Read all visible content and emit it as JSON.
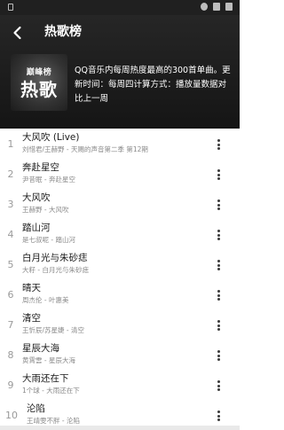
{
  "header": {
    "title": "热歌榜",
    "cover_top_text": "巅峰榜",
    "cover_main_text": "热歌",
    "description": "QQ音乐内每周热度最高的300首单曲。更新时间：每周四计算方式：播放量数据对比上一周"
  },
  "songs": [
    {
      "rank": "1",
      "title": "大风吹 (Live)",
      "artist": "刘惜君/王赫野 - 天赐的声音第二季 第12期"
    },
    {
      "rank": "2",
      "title": "奔赴星空",
      "artist": "尹昔眠 - 奔赴星空"
    },
    {
      "rank": "3",
      "title": "大风吹",
      "artist": "王赫野 - 大风吹"
    },
    {
      "rank": "4",
      "title": "踏山河",
      "artist": "是七叔呢 - 踏山河"
    },
    {
      "rank": "5",
      "title": "白月光与朱砂痣",
      "artist": "大籽 - 白月光与朱砂痣"
    },
    {
      "rank": "6",
      "title": "晴天",
      "artist": "周杰伦 - 叶惠美"
    },
    {
      "rank": "7",
      "title": "清空",
      "artist": "王忻辰/苏星婕 - 清空"
    },
    {
      "rank": "8",
      "title": "星辰大海",
      "artist": "黄霄雲 - 星辰大海"
    },
    {
      "rank": "9",
      "title": "大雨还在下",
      "artist": "1个球 - 大雨还在下"
    },
    {
      "rank": "10",
      "title": "沦陷",
      "artist": "王靖雯不胖 - 沦陷"
    }
  ]
}
